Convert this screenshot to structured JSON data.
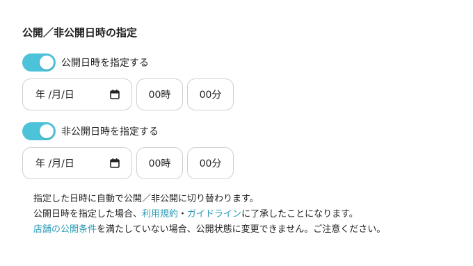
{
  "section": {
    "title": "公開／非公開日時の指定"
  },
  "publish": {
    "toggle_on": true,
    "toggle_label": "公開日時を指定する",
    "date_placeholder": "年 /月/日",
    "hour": "00時",
    "minute": "00分"
  },
  "unpublish": {
    "toggle_on": true,
    "toggle_label": "非公開日時を指定する",
    "date_placeholder": "年 /月/日",
    "hour": "00時",
    "minute": "00分"
  },
  "notes": {
    "line1": "指定した日時に自動で公開／非公開に切り替わります。",
    "line2_prefix": "公開日時を指定した場合、",
    "terms_link": "利用規約",
    "separator": "・",
    "guidelines_link": "ガイドライン",
    "line2_suffix": "に了承したことになります。",
    "conditions_link": "店舗の公開条件",
    "line3_suffix": "を満たしていない場合、公開状態に変更できません。ご注意ください。"
  },
  "icons": {
    "toggle": "toggle-switch",
    "calendar": "calendar-icon"
  },
  "colors": {
    "accent": "#4cc3d9",
    "link": "#2a9bb5",
    "border": "#cfcfcf",
    "text": "#222222"
  }
}
